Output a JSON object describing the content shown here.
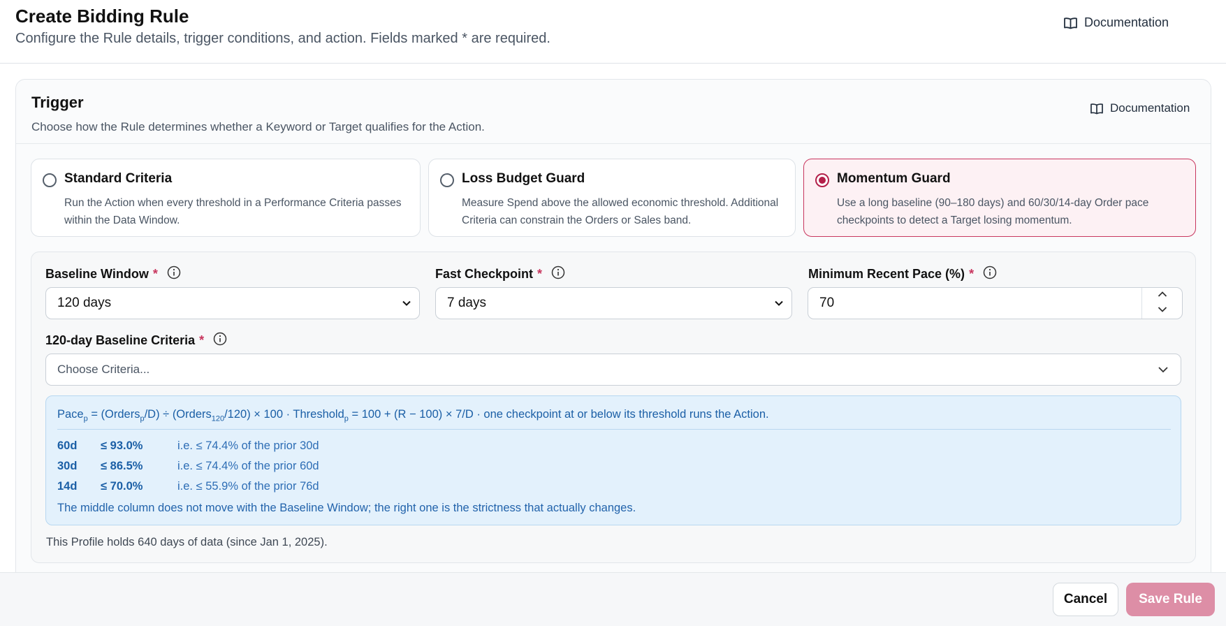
{
  "header": {
    "title": "Create Bidding Rule",
    "subtitle": "Configure the Rule details, trigger conditions, and action. Fields marked * are required.",
    "documentation_label": "Documentation"
  },
  "trigger": {
    "title": "Trigger",
    "description": "Choose how the Rule determines whether a Keyword or Target qualifies for the Action.",
    "documentation_label": "Documentation",
    "options": [
      {
        "title": "Standard Criteria",
        "description": "Run the Action when every threshold in a Performance Criteria passes within the Data Window.",
        "selected": false
      },
      {
        "title": "Loss Budget Guard",
        "description": "Measure Spend above the allowed economic threshold. Additional Criteria can constrain the Orders or Sales band.",
        "selected": false
      },
      {
        "title": "Momentum Guard",
        "description": "Use a long baseline (90–180 days) and 60/30/14-day Order pace checkpoints to detect a Target losing momentum.",
        "selected": true
      }
    ]
  },
  "fields": {
    "baseline_window": {
      "label": "Baseline Window",
      "required_mark": "*",
      "value": "120 days"
    },
    "fast_checkpoint": {
      "label": "Fast Checkpoint",
      "required_mark": "*",
      "value": "7 days"
    },
    "min_recent_pace": {
      "label": "Minimum Recent Pace (%)",
      "required_mark": "*",
      "value": "70"
    },
    "baseline_criteria": {
      "label": "120-day Baseline Criteria",
      "required_mark": "*",
      "placeholder": "Choose Criteria..."
    }
  },
  "formula": {
    "pace_prefix": "Pace",
    "p": "p",
    "eq_open": " = (Orders",
    "d_part": "/D) ÷ (Orders",
    "sub120": "120",
    "mid": "/120) × 100 · Threshold",
    "tail": " = 100 + (R − 100) × 7/D · one checkpoint at or below its threshold runs the Action."
  },
  "checkpoints": [
    {
      "window": "60d",
      "threshold": "≤ 93.0%",
      "explanation": "i.e. ≤ 74.4% of the prior 30d"
    },
    {
      "window": "30d",
      "threshold": "≤ 86.5%",
      "explanation": "i.e. ≤ 74.4% of the prior 60d"
    },
    {
      "window": "14d",
      "threshold": "≤ 70.0%",
      "explanation": "i.e. ≤ 55.9% of the prior 76d"
    }
  ],
  "note": "The middle column does not move with the Baseline Window; the right one is the strictness that actually changes.",
  "profile_note": "This Profile holds 640 days of data (since Jan 1, 2025).",
  "footer": {
    "cancel_label": "Cancel",
    "save_label": "Save Rule"
  },
  "colors": {
    "accent": "#c8365e",
    "info_bg": "#e3f1fc",
    "info_text": "#1b5fa6",
    "save_disabled": "#dd8ea6"
  }
}
